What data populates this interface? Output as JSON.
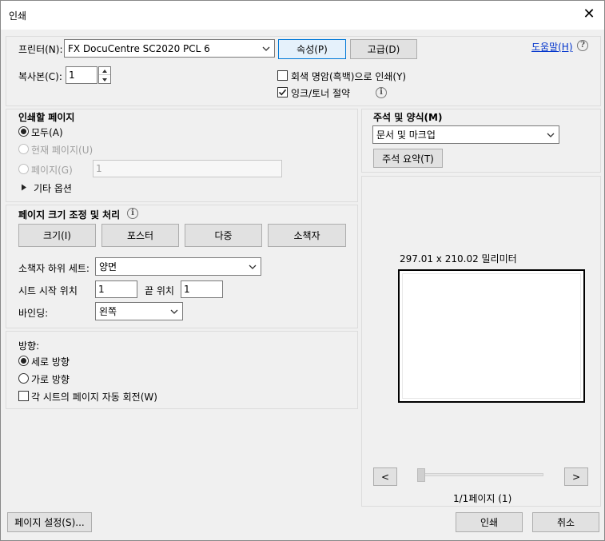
{
  "window": {
    "title": "인쇄"
  },
  "printer": {
    "label": "프린터(N):",
    "selected": "FX DocuCentre SC2020 PCL 6",
    "properties_button": "속성(P)",
    "advanced_button": "고급(D)",
    "help_link": "도움말(H)",
    "copies_label": "복사본(C):",
    "copies_value": "1",
    "grayscale_label": "회색 명암(흑백)으로 인쇄(Y)",
    "grayscale_checked": false,
    "save_ink_label": "잉크/토너 절약",
    "save_ink_checked": true
  },
  "pages_to_print": {
    "heading": "인쇄할 페이지",
    "all": "모두(A)",
    "current": "현재 페이지(U)",
    "pages": "페이지(G)",
    "pages_value": "1",
    "more_options": "기타 옵션",
    "selected": "all"
  },
  "comments": {
    "heading": "주석 및 양식(M)",
    "selected": "문서 및 마크업",
    "summarize_button": "주석 요약(T)"
  },
  "page_sizing": {
    "heading": "페이지 크기 조정 및 처리",
    "buttons": [
      "크기(I)",
      "포스터",
      "다중",
      "소책자"
    ],
    "booklet_subset_label": "소책자 하위 세트:",
    "booklet_subset_value": "양면",
    "sheets_from_label": "시트 시작 위치",
    "sheets_from_value": "1",
    "sheets_to_label": "끝 위치",
    "sheets_to_value": "1",
    "binding_label": "바인딩:",
    "binding_value": "왼쪽"
  },
  "orientation": {
    "heading": "방향:",
    "portrait": "세로 방향",
    "landscape": "가로 방향",
    "selected": "portrait",
    "auto_rotate_label": "각 시트의 페이지 자동 회전(W)",
    "auto_rotate_checked": false
  },
  "preview": {
    "dimensions": "297.01 x 210.02 밀리미터",
    "prev_button": "<",
    "next_button": ">",
    "page_indicator": "1/1페이지 (1)"
  },
  "footer": {
    "page_setup_button": "페이지 설정(S)...",
    "print_button": "인쇄",
    "cancel_button": "취소"
  }
}
